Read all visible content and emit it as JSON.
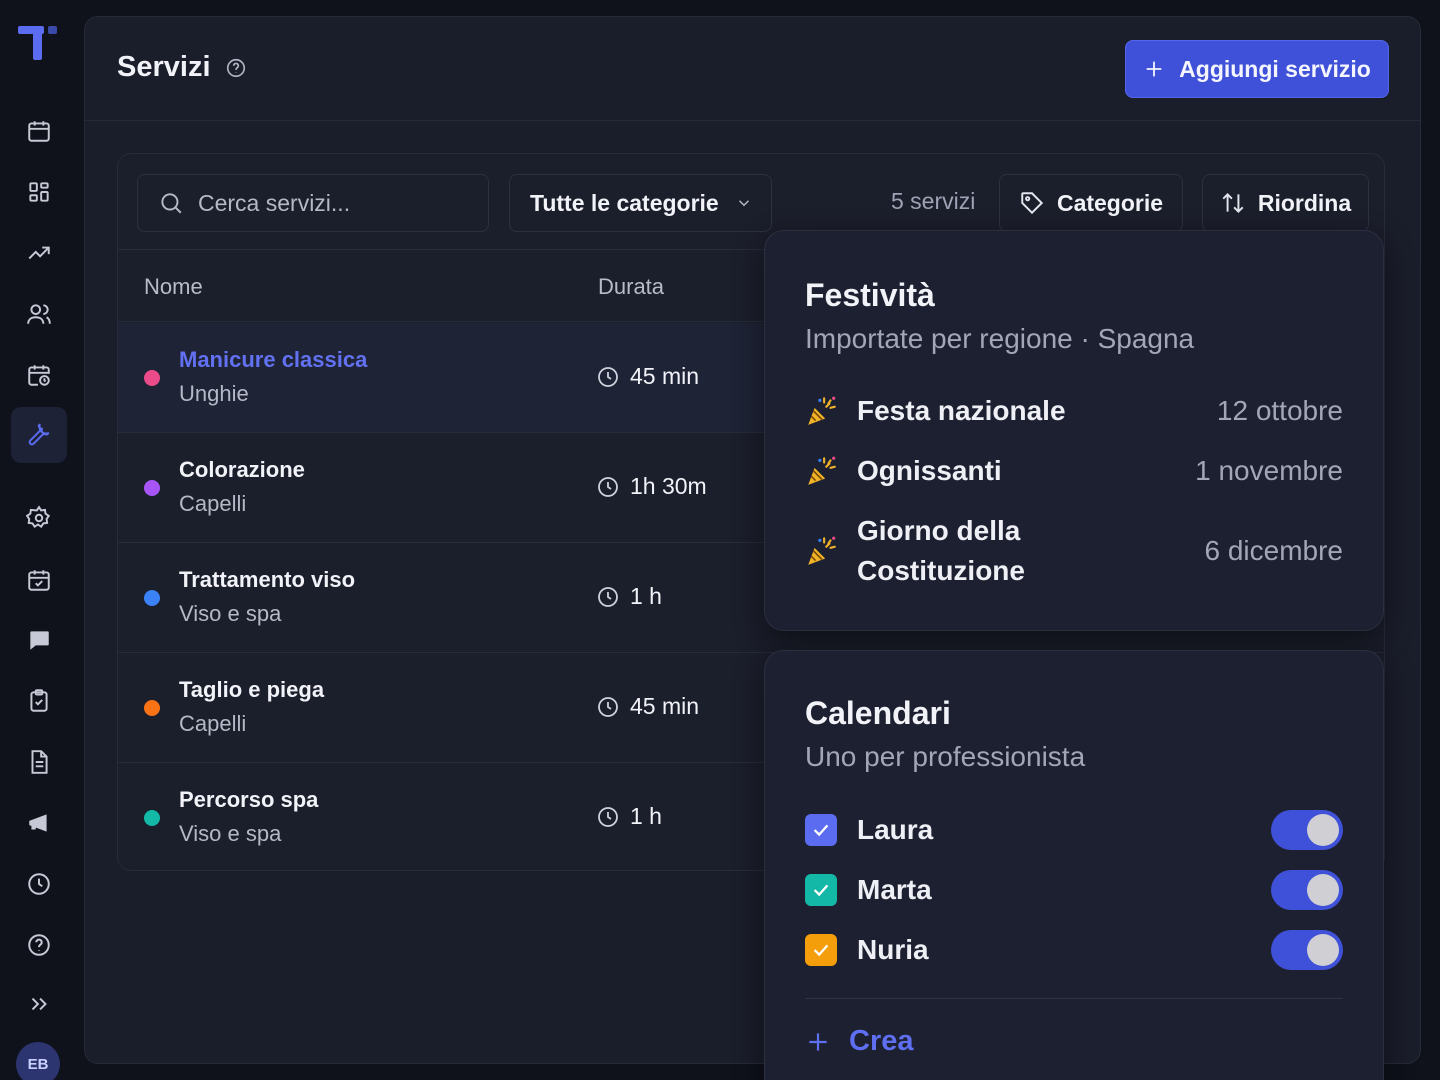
{
  "header": {
    "title": "Servizi",
    "add_button": "Aggiungi servizio"
  },
  "toolbar": {
    "search_placeholder": "Cerca servizi...",
    "category_select": "Tutte le categorie",
    "count": "5 servizi",
    "categories_button": "Categorie",
    "reorder_button": "Riordina"
  },
  "table": {
    "columns": [
      "Nome",
      "Durata"
    ],
    "rows": [
      {
        "name": "Manicure classica",
        "category": "Unghie",
        "duration": "45 min",
        "color": "#ec4b8a"
      },
      {
        "name": "Colorazione",
        "category": "Capelli",
        "duration": "1h 30m",
        "color": "#a855f7"
      },
      {
        "name": "Trattamento viso",
        "category": "Viso e spa",
        "duration": "1 h",
        "color": "#3b82f6"
      },
      {
        "name": "Taglio e piega",
        "category": "Capelli",
        "duration": "45 min",
        "color": "#f97316"
      },
      {
        "name": "Percorso spa",
        "category": "Viso e spa",
        "duration": "1 h",
        "color": "#14b8a6"
      }
    ]
  },
  "holidays": {
    "title": "Festività",
    "subtitle": "Importate per regione · Spagna",
    "items": [
      {
        "name": "Festa nazionale",
        "date": "12 ottobre"
      },
      {
        "name": "Ognissanti",
        "date": "1 novembre"
      },
      {
        "name": "Giorno della Costituzione",
        "date": "6 dicembre"
      }
    ]
  },
  "calendars": {
    "title": "Calendari",
    "subtitle": "Uno per professionista",
    "items": [
      {
        "name": "Laura",
        "color": "#5b6cf0",
        "enabled": true
      },
      {
        "name": "Marta",
        "color": "#14b8a6",
        "enabled": true
      },
      {
        "name": "Nuria",
        "color": "#f59e0b",
        "enabled": true
      }
    ],
    "create_label": "Crea"
  },
  "user": {
    "initials": "EB"
  }
}
